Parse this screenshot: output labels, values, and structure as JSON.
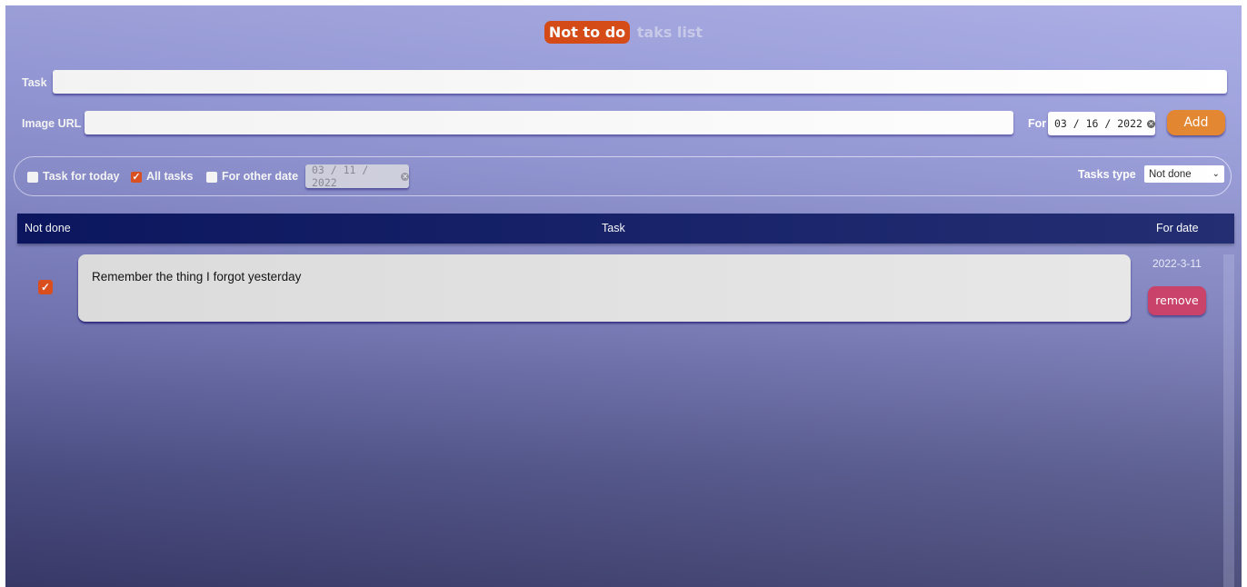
{
  "header": {
    "title_highlight": "Not to do",
    "title_rest": "taks list"
  },
  "form": {
    "task_label": "Task",
    "task_value": "",
    "image_label": "Image URL",
    "image_value": "",
    "for_label": "For",
    "for_date": "03 / 16 / 2022",
    "add_button": "Add"
  },
  "filters": {
    "today_label": "Task for today",
    "today_checked": false,
    "all_label": "All tasks",
    "all_checked": true,
    "other_label": "For other date",
    "other_checked": false,
    "other_date": "03 / 11 / 2022",
    "type_label": "Tasks type",
    "type_selected": "Not done"
  },
  "table": {
    "col_done": "Not done",
    "col_task": "Task",
    "col_date": "For date"
  },
  "tasks": [
    {
      "text": "Remember the thing I forgot yesterday",
      "date": "2022-3-11",
      "checked": true,
      "remove_label": "remove"
    }
  ],
  "colors": {
    "accent": "#d9440c",
    "add_button": "#e07a1c",
    "remove_button": "#c42f5a",
    "table_header": "#0b1763"
  }
}
